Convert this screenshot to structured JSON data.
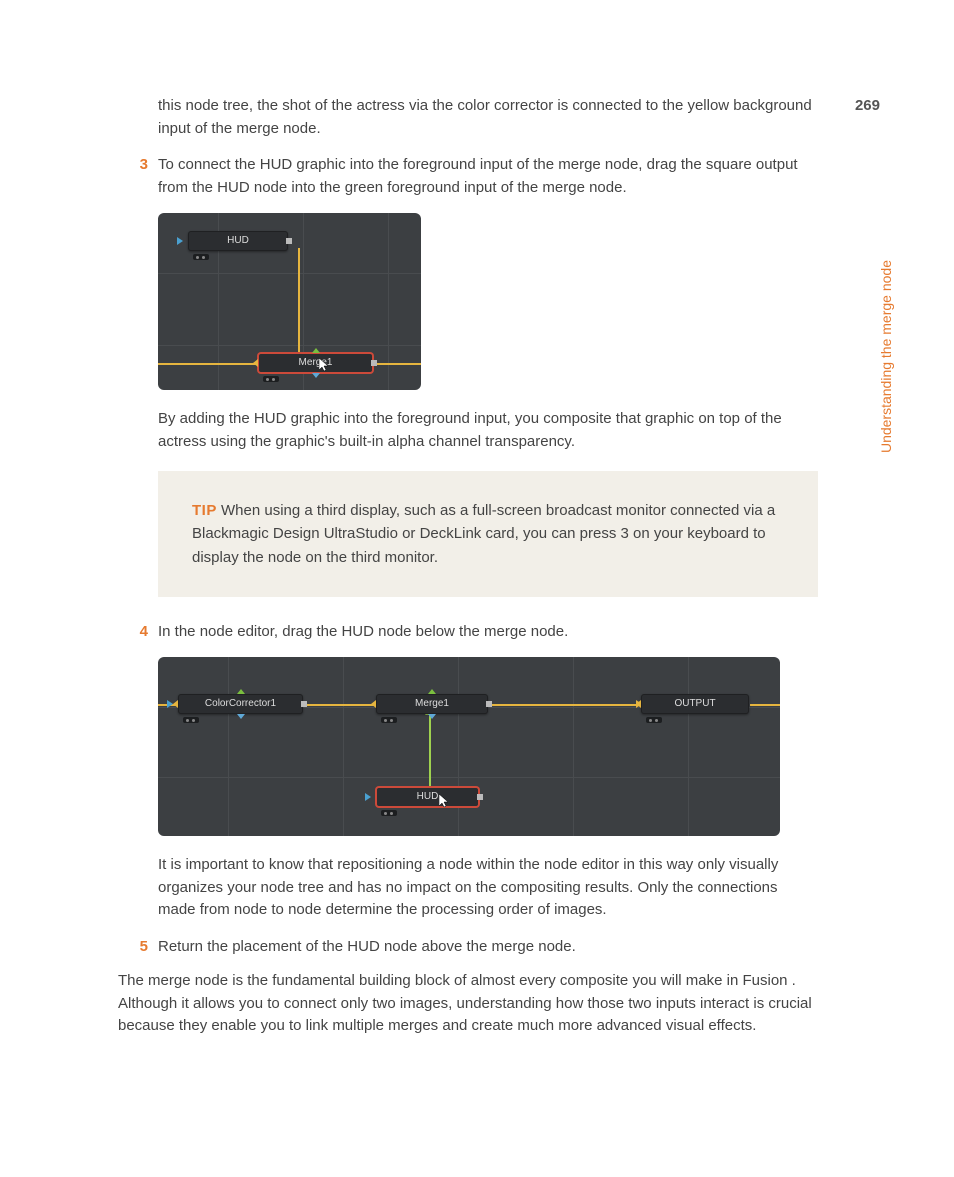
{
  "page_number": "269",
  "side_tab": "Understanding the merge node",
  "intro_para": "this node tree, the shot of the actress via the color corrector is connected to the yellow background input of the merge node.",
  "step3": {
    "num": "3",
    "text": "To connect the HUD graphic into the foreground input of the merge node, drag the square output from the HUD node into the green foreground input of the merge node.",
    "fig_nodes": {
      "hud": "HUD",
      "merge": "Merge1"
    },
    "after": "By adding the HUD graphic into the foreground input, you composite that graphic on top of the actress using the graphic's built-in alpha channel transparency."
  },
  "tip": {
    "label": "TIP",
    "text": "  When using a third display, such as a full-screen broadcast monitor connected via a Blackmagic Design UltraStudio or DeckLink card, you can press 3 on your keyboard to display the node on the third monitor."
  },
  "step4": {
    "num": "4",
    "text": "In the node editor, drag the HUD node below the merge node.",
    "fig_nodes": {
      "cc": "ColorCorrector1",
      "merge": "Merge1",
      "hud": "HUD",
      "out": "OUTPUT"
    },
    "after": "It is important to know that repositioning a node within the node editor in this way only visually organizes your node tree and has no impact on the compositing results. Only the connections made from node to node determine the processing order of images."
  },
  "step5": {
    "num": "5",
    "text": "Return the placement of the HUD node above the merge node."
  },
  "closing": "The merge node is the fundamental building block of almost every composite you will make in Fusion . Although it allows you to connect only two images, understanding how those two inputs interact is crucial because they enable you to link multiple merges and create much more advanced visual effects."
}
